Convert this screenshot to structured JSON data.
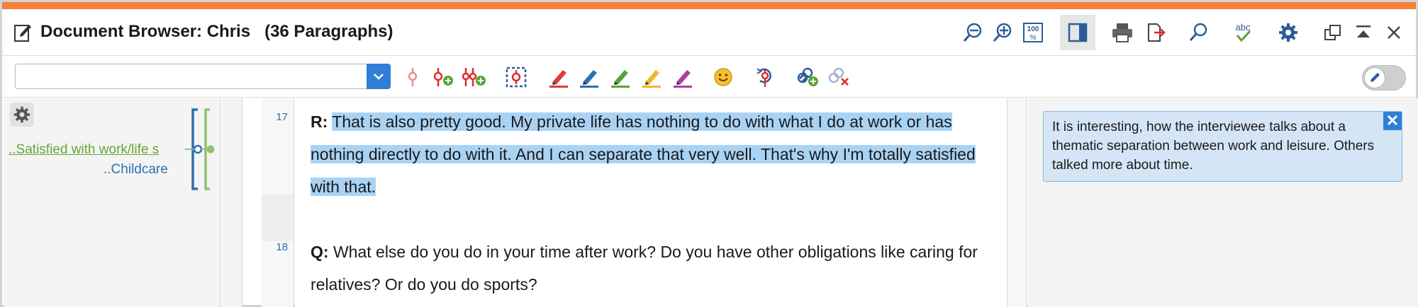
{
  "window": {
    "title_prefix": "Document Browser: Chris",
    "title_suffix": "(36 Paragraphs)",
    "accent_color": "#f5813a"
  },
  "titlebar_buttons": [
    {
      "name": "zoom-out-icon"
    },
    {
      "name": "zoom-in-icon"
    },
    {
      "name": "zoom-100-icon",
      "label": "100 %"
    },
    {
      "name": "sidebar-toggle-icon"
    },
    {
      "name": "print-icon"
    },
    {
      "name": "export-icon"
    },
    {
      "name": "search-icon"
    },
    {
      "name": "spellcheck-icon",
      "label": "abc"
    },
    {
      "name": "gear-icon"
    },
    {
      "name": "undock-window-icon"
    },
    {
      "name": "collapse-icon"
    },
    {
      "name": "close-icon"
    }
  ],
  "toolbar": {
    "code_combo_value": "",
    "tools": [
      {
        "name": "code-pin-icon"
      },
      {
        "name": "add-code-icon"
      },
      {
        "name": "add-codes-icon"
      },
      {
        "name": "selection-code-icon"
      },
      {
        "name": "highlighter-red-icon",
        "color": "#e23b3b"
      },
      {
        "name": "highlighter-blue-icon",
        "color": "#2c6fb0"
      },
      {
        "name": "highlighter-green-icon",
        "color": "#58a335"
      },
      {
        "name": "highlighter-yellow-icon",
        "color": "#f1b62b"
      },
      {
        "name": "highlighter-purple-icon",
        "color": "#b23aa8"
      },
      {
        "name": "emoticode-smiley-icon"
      },
      {
        "name": "undo-code-icon"
      },
      {
        "name": "add-link-icon"
      },
      {
        "name": "remove-link-icon"
      }
    ],
    "edit_mode": false
  },
  "code_margin": {
    "codes": [
      {
        "label": "..Satisfied with work/life s",
        "color": "#6aa534"
      },
      {
        "label": "..Childcare",
        "color": "#2c6fb0"
      }
    ]
  },
  "document": {
    "paragraphs": [
      {
        "number": "17",
        "speaker": "R:",
        "text": "That is also pretty good. My private life has nothing to do with what I do at work or has nothing directly to do with it. And I can separate that very well. That's why I'm totally satisfied with that.",
        "highlighted": true
      },
      {
        "number": "18",
        "speaker": "Q:",
        "text": "What else do you do in your time after work? Do you have other obligations like caring for relatives? Or do you do sports?",
        "highlighted": false
      }
    ]
  },
  "memo": {
    "text": "It is interesting, how the interviewee talks about a thematic separation between work and leisure. Others talked more about time.",
    "close_label": "✕"
  }
}
